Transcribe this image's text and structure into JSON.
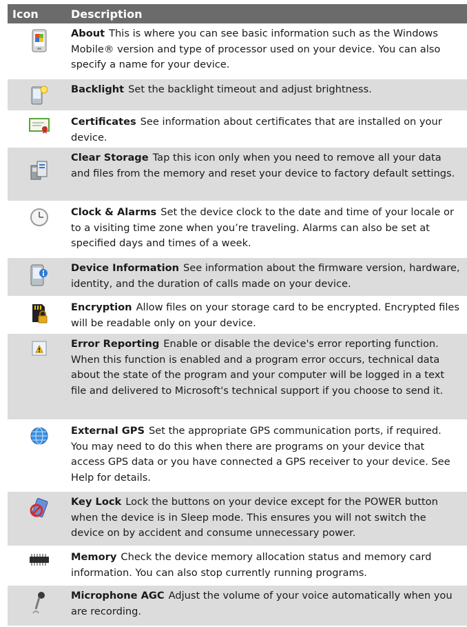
{
  "table": {
    "header": {
      "icon": "Icon",
      "description": "Description"
    },
    "rows": [
      {
        "icon": "about-phone-icon",
        "name": "About",
        "text": "This is where you can see basic information such as the Windows Mobile® version and type of processor used on your device. You can also specify a name for your device."
      },
      {
        "icon": "backlight-icon",
        "name": "Backlight",
        "text": "Set the backlight timeout and adjust brightness."
      },
      {
        "icon": "certificate-icon",
        "name": "Certificates",
        "text": "See information about certificates that are installed on your device."
      },
      {
        "icon": "clear-storage-icon",
        "name": "Clear Storage",
        "text": "Tap this icon only when you need to remove all your data and files from the memory and reset your device to factory default settings."
      },
      {
        "icon": "clock-icon",
        "name": "Clock & Alarms",
        "text": "Set the device clock to the date and time of your locale or to a visiting time zone when you’re traveling. Alarms can also be set at specified days and times of a week."
      },
      {
        "icon": "device-info-icon",
        "name": "Device Information",
        "text": "See information about the firmware version, hardware, identity, and the duration of calls made on your device."
      },
      {
        "icon": "encryption-icon",
        "name": "Encryption",
        "text": "Allow files on your storage card to be encrypted. Encrypted files will be readable only on your device."
      },
      {
        "icon": "error-report-icon",
        "name": "Error Reporting",
        "text": "Enable or disable the device's error reporting function. When this function is enabled and a program error occurs, technical data about the state of the program and your computer will be logged in a text file and delivered to Microsoft's technical support if you choose to send it."
      },
      {
        "icon": "globe-icon",
        "name": "External GPS",
        "text": "Set the appropriate GPS communication ports, if required. You may need to do this when there are programs on your device that access GPS data or you have connected a GPS receiver to your device. See Help for details."
      },
      {
        "icon": "key-lock-icon",
        "name": "Key Lock",
        "text": "Lock the buttons on your device except for the POWER button when the device is in Sleep mode. This ensures you will not switch the device on by accident and consume unnecessary power."
      },
      {
        "icon": "memory-chip-icon",
        "name": "Memory",
        "text": "Check the device memory allocation status and memory card information. You can also stop currently running programs."
      },
      {
        "icon": "microphone-icon",
        "name": "Microphone AGC",
        "text": "Adjust the volume of your voice automatically when you are recording."
      }
    ]
  }
}
